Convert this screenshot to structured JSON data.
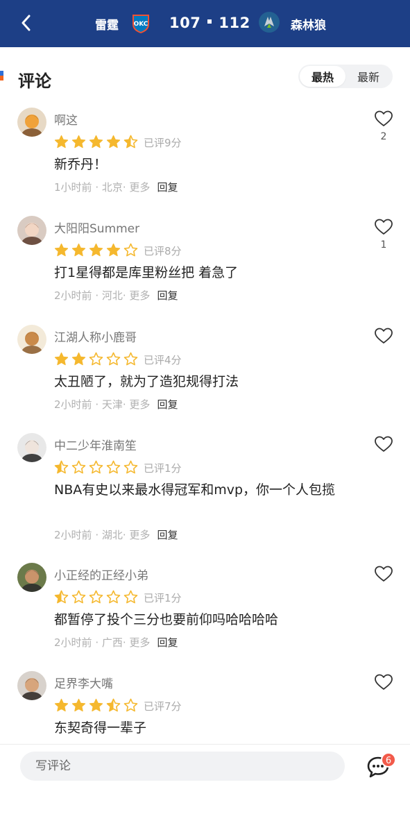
{
  "header": {
    "home_team": "雷霆",
    "home_logo_text": "OKC",
    "home_score": "107",
    "away_score": "112",
    "away_team": "森林狼",
    "brand_color": "#1d3f86"
  },
  "section": {
    "title": "评论",
    "sort_options": [
      "最热",
      "最新"
    ],
    "active_sort": "最热"
  },
  "comments": [
    {
      "user": "啊这",
      "stars": 4.5,
      "rating_text": "已评9分",
      "content": "新乔丹！",
      "time": "1小时前",
      "location": "北京",
      "more": "更多",
      "reply": "回复",
      "likes": "2"
    },
    {
      "user": "大阳阳Summer",
      "stars": 4,
      "rating_text": "已评8分",
      "content": "打1星得都是库里粉丝把 着急了",
      "time": "2小时前",
      "location": "河北",
      "more": "更多",
      "reply": "回复",
      "likes": "1"
    },
    {
      "user": "江湖人称小鹿哥",
      "stars": 2,
      "rating_text": "已评4分",
      "content": "太丑陋了，就为了造犯规得打法",
      "time": "2小时前",
      "location": "天津",
      "more": "更多",
      "reply": "回复",
      "likes": ""
    },
    {
      "user": "中二少年淮南笙",
      "stars": 0.5,
      "rating_text": "已评1分",
      "content": "NBA有史以来最水得冠军和mvp，你一个人包揽",
      "time": "2小时前",
      "location": "湖北",
      "more": "更多",
      "reply": "回复",
      "likes": ""
    },
    {
      "user": "小正经的正经小弟",
      "stars": 0.5,
      "rating_text": "已评1分",
      "content": "都暂停了投个三分也要前仰吗哈哈哈哈",
      "time": "2小时前",
      "location": "广西",
      "more": "更多",
      "reply": "回复",
      "likes": ""
    },
    {
      "user": "足界李大嘴",
      "stars": 3.5,
      "rating_text": "已评7分",
      "content": "东契奇得一辈子",
      "time": "",
      "location": "",
      "more": "",
      "reply": "",
      "likes": ""
    }
  ],
  "bottom": {
    "input_placeholder": "写评论",
    "badge_count": "6"
  },
  "colors": {
    "star": "#f5b82e",
    "star_empty_stroke": "#f5b82e",
    "badge": "#f25a4a"
  }
}
